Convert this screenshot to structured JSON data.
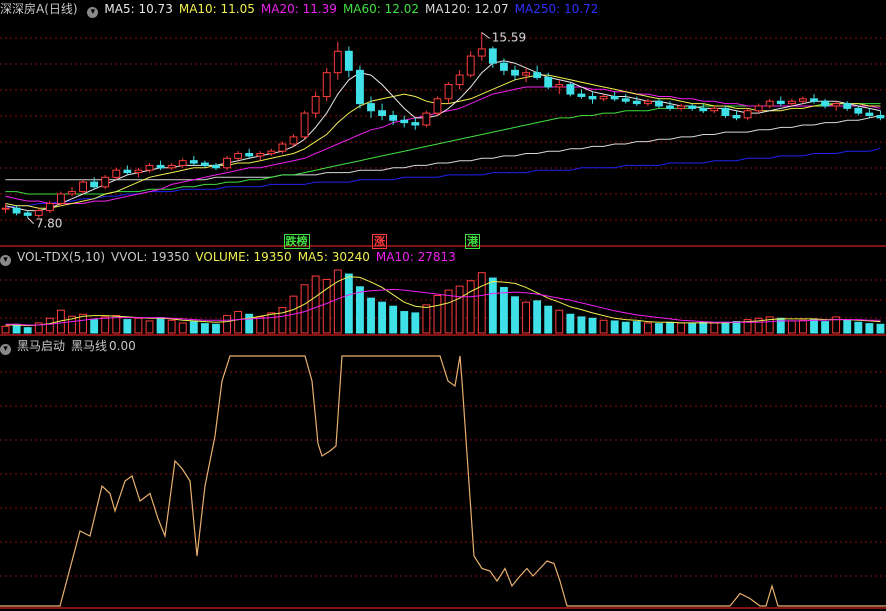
{
  "colors": {
    "bg": "#000000",
    "up": "#ff3c3c",
    "down": "#40e0e8",
    "grid": "#8a1010",
    "ma5": "#e8e8e8",
    "ma10": "#f0f050",
    "ma20": "#f020f0",
    "ma60": "#40e040",
    "ma120": "#d8d8d8",
    "ma250": "#2020f0",
    "blackhorse": "#e8b070"
  },
  "price_panel": {
    "stock_name": "深深房A",
    "period": "(日线)",
    "ma_labels": [
      {
        "name": "MA5",
        "value": "10.73",
        "color": "#e8e8e8"
      },
      {
        "name": "MA10",
        "value": "11.05",
        "color": "#f0f050"
      },
      {
        "name": "MA20",
        "value": "11.39",
        "color": "#f020f0"
      },
      {
        "name": "MA60",
        "value": "12.02",
        "color": "#40e040"
      },
      {
        "name": "MA120",
        "value": "12.07",
        "color": "#d8d8d8"
      },
      {
        "name": "MA250",
        "value": "10.72",
        "color": "#3030ff"
      }
    ],
    "max_label": "15.59",
    "min_label": "7.80",
    "signals": [
      {
        "text": "跌榜",
        "color": "#40e040",
        "pos": 0.32
      },
      {
        "text": "涨",
        "color": "#ff3c3c",
        "pos": 0.42
      },
      {
        "text": "港",
        "color": "#40e040",
        "pos": 0.525
      }
    ]
  },
  "vol_panel": {
    "indicator": "VOL-TDX(5,10)",
    "items": [
      {
        "name": "VVOL",
        "value": "19350",
        "color": "#c8c8c8"
      },
      {
        "name": "VOLUME",
        "value": "19350",
        "color": "#f0f050"
      },
      {
        "name": "MA5",
        "value": "30240",
        "color": "#f0f050"
      },
      {
        "name": "MA10",
        "value": "27813",
        "color": "#f020f0"
      }
    ]
  },
  "bh_panel": {
    "indicator": "黑马启动",
    "line_name": "黑马线",
    "line_value": "0.00"
  },
  "chart_data": {
    "type": "candlestick",
    "price_range": [
      7.8,
      15.59
    ],
    "candles": [
      [
        8.2,
        8.4,
        8.0,
        8.2
      ],
      [
        8.2,
        8.3,
        7.9,
        8.0
      ],
      [
        8.0,
        8.1,
        7.8,
        7.9
      ],
      [
        7.9,
        8.2,
        7.8,
        8.1
      ],
      [
        8.1,
        8.5,
        8.0,
        8.4
      ],
      [
        8.4,
        8.9,
        8.3,
        8.8
      ],
      [
        8.8,
        9.1,
        8.7,
        8.9
      ],
      [
        8.9,
        9.4,
        8.8,
        9.3
      ],
      [
        9.3,
        9.5,
        9.0,
        9.1
      ],
      [
        9.1,
        9.6,
        9.0,
        9.5
      ],
      [
        9.5,
        9.9,
        9.4,
        9.8
      ],
      [
        9.8,
        10.0,
        9.6,
        9.7
      ],
      [
        9.7,
        9.9,
        9.5,
        9.8
      ],
      [
        9.8,
        10.1,
        9.7,
        10.0
      ],
      [
        10.0,
        10.2,
        9.8,
        9.9
      ],
      [
        9.9,
        10.1,
        9.8,
        10.0
      ],
      [
        10.0,
        10.3,
        9.9,
        10.2
      ],
      [
        10.2,
        10.4,
        10.0,
        10.1
      ],
      [
        10.1,
        10.2,
        9.9,
        10.0
      ],
      [
        10.0,
        10.1,
        9.8,
        9.9
      ],
      [
        9.9,
        10.4,
        9.8,
        10.3
      ],
      [
        10.3,
        10.6,
        10.2,
        10.5
      ],
      [
        10.5,
        10.7,
        10.3,
        10.4
      ],
      [
        10.4,
        10.6,
        10.2,
        10.5
      ],
      [
        10.5,
        10.7,
        10.4,
        10.6
      ],
      [
        10.6,
        11.0,
        10.5,
        10.9
      ],
      [
        10.9,
        11.3,
        10.8,
        11.2
      ],
      [
        11.2,
        12.3,
        11.1,
        12.2
      ],
      [
        12.2,
        13.1,
        12.0,
        12.9
      ],
      [
        12.9,
        14.1,
        12.7,
        13.9
      ],
      [
        13.9,
        15.2,
        13.6,
        14.8
      ],
      [
        14.8,
        15.0,
        13.7,
        14.0
      ],
      [
        14.0,
        14.2,
        12.4,
        12.6
      ],
      [
        12.6,
        12.9,
        12.0,
        12.3
      ],
      [
        12.3,
        12.6,
        11.9,
        12.1
      ],
      [
        12.1,
        12.3,
        11.7,
        11.9
      ],
      [
        11.9,
        12.1,
        11.6,
        11.8
      ],
      [
        11.8,
        12.0,
        11.5,
        11.7
      ],
      [
        11.7,
        12.3,
        11.6,
        12.2
      ],
      [
        12.2,
        12.9,
        12.1,
        12.8
      ],
      [
        12.8,
        13.5,
        12.6,
        13.4
      ],
      [
        13.4,
        14.0,
        13.2,
        13.8
      ],
      [
        13.8,
        14.8,
        13.7,
        14.6
      ],
      [
        14.6,
        15.59,
        14.4,
        14.9
      ],
      [
        14.9,
        15.0,
        14.1,
        14.3
      ],
      [
        14.3,
        14.5,
        13.8,
        14.0
      ],
      [
        14.0,
        14.2,
        13.6,
        13.8
      ],
      [
        13.8,
        14.1,
        13.5,
        13.9
      ],
      [
        13.9,
        14.2,
        13.6,
        13.7
      ],
      [
        13.7,
        13.9,
        13.2,
        13.3
      ],
      [
        13.3,
        13.6,
        13.0,
        13.4
      ],
      [
        13.4,
        13.5,
        12.9,
        13.0
      ],
      [
        13.0,
        13.2,
        12.8,
        12.9
      ],
      [
        12.9,
        13.1,
        12.6,
        12.8
      ],
      [
        12.8,
        13.0,
        12.7,
        12.9
      ],
      [
        12.9,
        13.1,
        12.7,
        12.8
      ],
      [
        12.8,
        13.0,
        12.6,
        12.7
      ],
      [
        12.7,
        12.9,
        12.5,
        12.6
      ],
      [
        12.6,
        12.8,
        12.5,
        12.7
      ],
      [
        12.7,
        12.8,
        12.4,
        12.5
      ],
      [
        12.5,
        12.7,
        12.3,
        12.4
      ],
      [
        12.4,
        12.6,
        12.3,
        12.5
      ],
      [
        12.5,
        12.6,
        12.3,
        12.4
      ],
      [
        12.4,
        12.6,
        12.2,
        12.3
      ],
      [
        12.3,
        12.5,
        12.2,
        12.4
      ],
      [
        12.4,
        12.5,
        12.0,
        12.1
      ],
      [
        12.1,
        12.3,
        11.9,
        12.0
      ],
      [
        12.0,
        12.4,
        11.9,
        12.3
      ],
      [
        12.3,
        12.6,
        12.2,
        12.5
      ],
      [
        12.5,
        12.8,
        12.4,
        12.7
      ],
      [
        12.7,
        12.9,
        12.5,
        12.6
      ],
      [
        12.6,
        12.8,
        12.5,
        12.7
      ],
      [
        12.7,
        12.9,
        12.6,
        12.8
      ],
      [
        12.8,
        13.0,
        12.6,
        12.7
      ],
      [
        12.7,
        12.8,
        12.4,
        12.5
      ],
      [
        12.5,
        12.7,
        12.3,
        12.6
      ],
      [
        12.6,
        12.7,
        12.3,
        12.4
      ],
      [
        12.4,
        12.5,
        12.1,
        12.2
      ],
      [
        12.2,
        12.4,
        12.0,
        12.1
      ],
      [
        12.1,
        12.3,
        11.9,
        12.0
      ]
    ],
    "ma": {
      "ma5": [
        8.3,
        8.2,
        8.1,
        8.1,
        8.2,
        8.4,
        8.6,
        8.8,
        9.0,
        9.2,
        9.4,
        9.6,
        9.7,
        9.8,
        9.9,
        9.9,
        10.0,
        10.0,
        10.0,
        10.0,
        10.1,
        10.2,
        10.3,
        10.4,
        10.5,
        10.6,
        10.8,
        11.1,
        11.6,
        12.2,
        13.0,
        13.6,
        13.9,
        13.8,
        13.4,
        12.9,
        12.4,
        12.0,
        12.0,
        12.1,
        12.4,
        12.8,
        13.3,
        13.9,
        14.3,
        14.4,
        14.3,
        14.1,
        13.9,
        13.7,
        13.6,
        13.5,
        13.3,
        13.1,
        13.0,
        12.9,
        12.9,
        12.8,
        12.7,
        12.7,
        12.6,
        12.5,
        12.5,
        12.4,
        12.4,
        12.4,
        12.3,
        12.2,
        12.2,
        12.3,
        12.4,
        12.5,
        12.6,
        12.7,
        12.7,
        12.7,
        12.6,
        12.5,
        12.4,
        12.3
      ],
      "ma10": [
        8.4,
        8.3,
        8.3,
        8.2,
        8.2,
        8.3,
        8.4,
        8.5,
        8.6,
        8.8,
        8.9,
        9.1,
        9.3,
        9.5,
        9.6,
        9.7,
        9.8,
        9.9,
        9.9,
        10.0,
        10.0,
        10.1,
        10.1,
        10.2,
        10.3,
        10.4,
        10.5,
        10.7,
        11.0,
        11.3,
        11.8,
        12.2,
        12.5,
        12.7,
        12.8,
        12.9,
        13.0,
        12.9,
        12.7,
        12.6,
        12.6,
        12.7,
        12.8,
        13.0,
        13.2,
        13.4,
        13.6,
        13.7,
        13.8,
        13.8,
        13.7,
        13.6,
        13.5,
        13.4,
        13.3,
        13.2,
        13.1,
        13.0,
        12.9,
        12.8,
        12.8,
        12.7,
        12.6,
        12.6,
        12.5,
        12.5,
        12.4,
        12.4,
        12.3,
        12.3,
        12.3,
        12.4,
        12.4,
        12.5,
        12.5,
        12.6,
        12.6,
        12.6,
        12.5,
        12.5
      ],
      "ma20": [
        8.7,
        8.6,
        8.5,
        8.5,
        8.4,
        8.4,
        8.4,
        8.4,
        8.5,
        8.5,
        8.6,
        8.7,
        8.8,
        8.9,
        9.0,
        9.2,
        9.3,
        9.4,
        9.5,
        9.6,
        9.7,
        9.8,
        9.9,
        9.9,
        10.0,
        10.1,
        10.2,
        10.3,
        10.5,
        10.7,
        10.9,
        11.1,
        11.3,
        11.5,
        11.6,
        11.8,
        11.9,
        12.0,
        12.1,
        12.2,
        12.3,
        12.4,
        12.6,
        12.8,
        13.0,
        13.1,
        13.2,
        13.3,
        13.3,
        13.3,
        13.3,
        13.3,
        13.3,
        13.2,
        13.2,
        13.1,
        13.1,
        13.0,
        13.0,
        12.9,
        12.9,
        12.8,
        12.8,
        12.7,
        12.7,
        12.6,
        12.6,
        12.5,
        12.5,
        12.5,
        12.5,
        12.5,
        12.5,
        12.5,
        12.5,
        12.5,
        12.5,
        12.5,
        12.5,
        12.4
      ],
      "ma60": [
        8.9,
        8.9,
        8.8,
        8.8,
        8.8,
        8.8,
        8.8,
        8.8,
        8.8,
        8.8,
        8.9,
        8.9,
        8.9,
        9.0,
        9.0,
        9.0,
        9.1,
        9.1,
        9.2,
        9.2,
        9.3,
        9.3,
        9.4,
        9.4,
        9.5,
        9.6,
        9.6,
        9.7,
        9.8,
        9.9,
        10.0,
        10.1,
        10.2,
        10.3,
        10.4,
        10.5,
        10.6,
        10.7,
        10.8,
        10.9,
        11.0,
        11.1,
        11.2,
        11.3,
        11.4,
        11.5,
        11.6,
        11.7,
        11.8,
        11.9,
        12.0,
        12.0,
        12.1,
        12.1,
        12.2,
        12.2,
        12.3,
        12.3,
        12.3,
        12.4,
        12.4,
        12.4,
        12.4,
        12.5,
        12.5,
        12.5,
        12.5,
        12.5,
        12.5,
        12.5,
        12.5,
        12.5,
        12.5,
        12.5,
        12.6,
        12.6,
        12.6,
        12.6,
        12.6,
        12.6
      ],
      "ma120": [
        9.4,
        9.4,
        9.4,
        9.4,
        9.4,
        9.4,
        9.4,
        9.4,
        9.4,
        9.4,
        9.4,
        9.4,
        9.4,
        9.4,
        9.4,
        9.4,
        9.4,
        9.4,
        9.4,
        9.5,
        9.5,
        9.5,
        9.5,
        9.5,
        9.5,
        9.6,
        9.6,
        9.6,
        9.6,
        9.7,
        9.7,
        9.7,
        9.8,
        9.8,
        9.8,
        9.9,
        9.9,
        10.0,
        10.0,
        10.1,
        10.1,
        10.2,
        10.2,
        10.3,
        10.3,
        10.4,
        10.4,
        10.5,
        10.5,
        10.6,
        10.6,
        10.7,
        10.7,
        10.8,
        10.8,
        10.9,
        10.9,
        11.0,
        11.0,
        11.1,
        11.1,
        11.2,
        11.2,
        11.3,
        11.3,
        11.4,
        11.4,
        11.4,
        11.5,
        11.5,
        11.6,
        11.6,
        11.7,
        11.7,
        11.8,
        11.8,
        11.9,
        11.9,
        12.0,
        12.1
      ],
      "ma250": [
        8.2,
        8.3,
        8.3,
        8.4,
        8.4,
        8.5,
        8.5,
        8.6,
        8.6,
        8.7,
        8.7,
        8.8,
        8.8,
        8.9,
        8.9,
        8.9,
        9.0,
        9.0,
        9.0,
        9.0,
        9.1,
        9.1,
        9.1,
        9.1,
        9.2,
        9.2,
        9.2,
        9.2,
        9.3,
        9.3,
        9.3,
        9.3,
        9.4,
        9.4,
        9.4,
        9.4,
        9.5,
        9.5,
        9.5,
        9.5,
        9.6,
        9.6,
        9.6,
        9.6,
        9.7,
        9.7,
        9.7,
        9.7,
        9.8,
        9.8,
        9.8,
        9.8,
        9.9,
        9.9,
        9.9,
        9.9,
        10.0,
        10.0,
        10.0,
        10.0,
        10.1,
        10.1,
        10.1,
        10.1,
        10.2,
        10.2,
        10.2,
        10.3,
        10.3,
        10.3,
        10.4,
        10.4,
        10.4,
        10.5,
        10.5,
        10.5,
        10.6,
        10.6,
        10.6,
        10.72
      ]
    },
    "volume": [
      1.0,
      1.3,
      0.8,
      1.5,
      2.2,
      3.4,
      2.5,
      2.8,
      2.0,
      2.4,
      2.6,
      2.0,
      2.2,
      1.8,
      2.3,
      1.9,
      1.5,
      1.7,
      1.4,
      1.3,
      2.6,
      3.2,
      2.8,
      2.4,
      3.0,
      3.8,
      5.5,
      7.2,
      8.5,
      8.0,
      9.4,
      8.8,
      6.9,
      5.2,
      4.6,
      4.0,
      3.2,
      3.0,
      4.2,
      5.6,
      6.4,
      7.0,
      7.8,
      9.0,
      8.2,
      6.8,
      5.4,
      4.6,
      4.8,
      4.0,
      3.4,
      2.8,
      2.4,
      2.2,
      1.9,
      1.8,
      1.6,
      1.7,
      1.5,
      1.4,
      1.6,
      1.5,
      1.4,
      1.6,
      1.5,
      1.6,
      1.7,
      2.0,
      2.2,
      2.4,
      2.2,
      1.8,
      1.9,
      2.0,
      1.7,
      2.4,
      1.9,
      1.6,
      1.4,
      1.3
    ],
    "vol_ma5": [
      1.2,
      1.2,
      1.1,
      1.2,
      1.4,
      1.8,
      2.1,
      2.5,
      2.6,
      2.6,
      2.5,
      2.4,
      2.3,
      2.2,
      2.2,
      2.1,
      1.9,
      1.8,
      1.7,
      1.6,
      1.7,
      2.0,
      2.2,
      2.5,
      2.8,
      3.0,
      3.5,
      4.3,
      5.4,
      6.6,
      7.7,
      8.4,
      8.3,
      7.6,
      6.8,
      5.7,
      4.6,
      4.0,
      3.8,
      4.1,
      4.5,
      5.2,
      6.2,
      7.0,
      7.7,
      7.6,
      7.4,
      6.8,
      6.0,
      5.2,
      4.6,
      3.9,
      3.5,
      3.0,
      2.6,
      2.2,
      2.0,
      1.9,
      1.7,
      1.6,
      1.6,
      1.5,
      1.5,
      1.5,
      1.5,
      1.5,
      1.6,
      1.7,
      1.8,
      2.0,
      2.1,
      2.1,
      2.1,
      2.1,
      2.0,
      2.0,
      2.0,
      1.9,
      1.8,
      1.7
    ],
    "vol_ma10": [
      1.3,
      1.3,
      1.2,
      1.2,
      1.3,
      1.5,
      1.7,
      1.9,
      2.1,
      2.2,
      2.3,
      2.3,
      2.3,
      2.3,
      2.3,
      2.2,
      2.1,
      2.0,
      1.9,
      1.9,
      1.9,
      2.0,
      2.1,
      2.2,
      2.3,
      2.5,
      2.8,
      3.2,
      3.8,
      4.4,
      5.1,
      5.7,
      6.1,
      6.3,
      6.4,
      6.5,
      6.4,
      6.2,
      6.0,
      5.8,
      5.6,
      5.4,
      5.4,
      5.6,
      5.9,
      6.0,
      6.1,
      6.0,
      5.8,
      5.5,
      5.2,
      4.9,
      4.5,
      4.1,
      3.7,
      3.3,
      3.0,
      2.7,
      2.5,
      2.3,
      2.1,
      1.9,
      1.8,
      1.7,
      1.6,
      1.6,
      1.6,
      1.6,
      1.6,
      1.7,
      1.8,
      1.8,
      1.8,
      1.9,
      1.9,
      2.0,
      2.0,
      2.0,
      1.9,
      1.9
    ],
    "blackhorse": {
      "ylim": [
        0,
        100
      ],
      "points": [
        [
          0,
          0
        ],
        [
          60,
          0
        ],
        [
          80,
          30
        ],
        [
          90,
          28
        ],
        [
          102,
          48
        ],
        [
          110,
          45
        ],
        [
          115,
          38
        ],
        [
          125,
          50
        ],
        [
          132,
          52
        ],
        [
          140,
          42
        ],
        [
          150,
          45
        ],
        [
          158,
          35
        ],
        [
          165,
          28
        ],
        [
          175,
          58
        ],
        [
          182,
          55
        ],
        [
          190,
          50
        ],
        [
          197,
          20
        ],
        [
          205,
          48
        ],
        [
          215,
          68
        ],
        [
          222,
          90
        ],
        [
          230,
          100
        ],
        [
          305,
          100
        ],
        [
          312,
          90
        ],
        [
          318,
          65
        ],
        [
          322,
          60
        ],
        [
          330,
          62
        ],
        [
          336,
          64
        ],
        [
          342,
          100
        ],
        [
          440,
          100
        ],
        [
          448,
          90
        ],
        [
          455,
          88
        ],
        [
          460,
          100
        ],
        [
          462,
          90
        ],
        [
          468,
          55
        ],
        [
          474,
          20
        ],
        [
          482,
          15
        ],
        [
          490,
          14
        ],
        [
          497,
          10
        ],
        [
          505,
          15
        ],
        [
          512,
          8
        ],
        [
          520,
          12
        ],
        [
          527,
          15
        ],
        [
          533,
          12
        ],
        [
          540,
          15
        ],
        [
          547,
          18
        ],
        [
          554,
          17
        ],
        [
          560,
          10
        ],
        [
          567,
          0
        ],
        [
          730,
          0
        ],
        [
          740,
          5
        ],
        [
          750,
          3
        ],
        [
          760,
          0
        ],
        [
          766,
          0
        ],
        [
          772,
          8
        ],
        [
          778,
          0
        ],
        [
          886,
          0
        ]
      ]
    }
  }
}
